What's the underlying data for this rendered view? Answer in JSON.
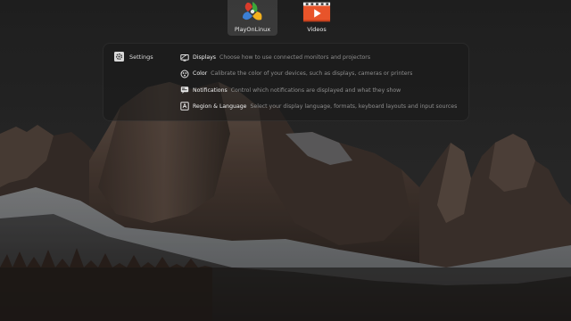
{
  "apps": [
    {
      "label": "PlayOnLinux",
      "icon": "playonlinux-icon",
      "selected": true
    },
    {
      "label": "Videos",
      "icon": "videos-icon",
      "selected": false
    }
  ],
  "search": {
    "provider": {
      "label": "Settings",
      "icon": "gear-icon"
    },
    "results": [
      {
        "title": "Displays",
        "description": "Choose how to use connected monitors and projectors",
        "icon": "display-icon"
      },
      {
        "title": "Color",
        "description": "Calibrate the color of your devices, such as displays, cameras or printers",
        "icon": "color-icon"
      },
      {
        "title": "Notifications",
        "description": "Control which notifications are displayed and what they show",
        "icon": "notifications-icon"
      },
      {
        "title": "Region & Language",
        "description": "Select your display language, formats, keyboard layouts and input sources",
        "icon": "region-language-icon"
      }
    ]
  },
  "colors": {
    "panel_bg": "#191919",
    "text_primary": "#f2f2f2",
    "text_secondary": "#8e8e8e",
    "videos_accent": "#e8542a"
  }
}
